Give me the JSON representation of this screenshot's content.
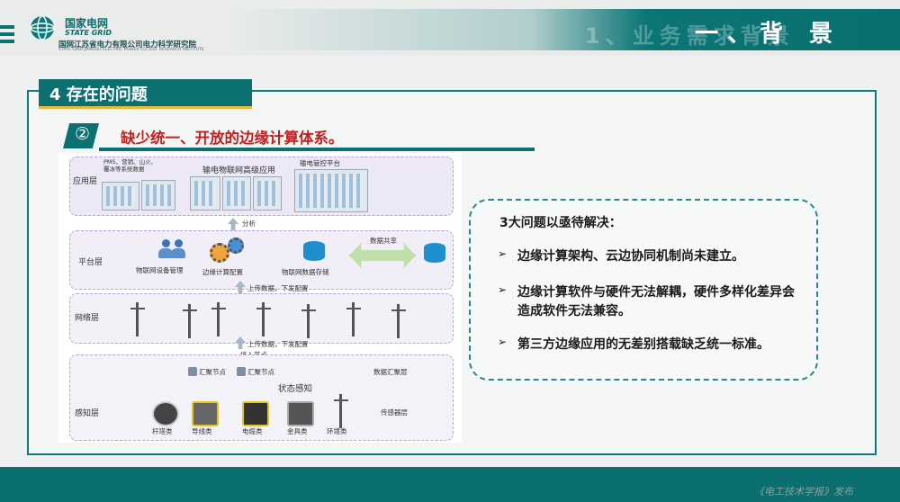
{
  "header": {
    "logo_cn": "国家电网",
    "logo_en": "STATE GRID",
    "org_cn": "国网江苏省电力有限公司电力科学研究院",
    "org_en": "STATE GRID JIANGSU ELECTRIC POWER CO.,LTD. RESEARCH INSTITUTE",
    "ghost_text": "1、业务需求背景",
    "title": "一、背 景"
  },
  "section": {
    "tab": "4 存在的问题",
    "badge": "②",
    "subtitle": "缺少统一、开放的边缘计算体系。"
  },
  "diagram": {
    "layers": {
      "application": "应用层",
      "platform": "平台层",
      "network": "网络层",
      "perception": "感知层"
    },
    "app_items": {
      "systems": "PMS、营销、山火、覆冰等系统数据",
      "iot_app": "输电物联网高级应用",
      "control_platform": "输电管控平台"
    },
    "arrows": {
      "analysis": "分析",
      "upload_config": "上传数据，下发配置",
      "upload_config_2": "上传数据，下发配置",
      "access_node": "接入节点",
      "data_share": "数据共享"
    },
    "platform_items": {
      "device_mgmt": "物联网设备管理",
      "edge_config": "边缘计算配置",
      "data_storage": "物联网数据存储"
    },
    "perception_items": {
      "gather_node": "汇聚节点",
      "sink_node": "汇聚节点",
      "state_sense": "状态感知",
      "data_layer": "数据汇聚层",
      "sensor_layer": "传感器层",
      "sensors": [
        "杆塔类",
        "导线类",
        "电缆类",
        "金具类",
        "环境类"
      ]
    }
  },
  "callout": {
    "heading": "3大问题以亟待解决：",
    "bullets": [
      "边缘计算架构、云边协同机制尚未建立。",
      "边缘计算软件与硬件无法解耦，硬件多样化差异会造成软件无法兼容。",
      "第三方边缘应用的无差别搭载缺乏统一标准。"
    ],
    "bullet_mark": "➢"
  },
  "footer": {
    "watermark": "《电工技术学报》发布"
  },
  "colors": {
    "accent": "#0c7070",
    "highlight": "#c21f1f",
    "underline": "#eab93a"
  }
}
